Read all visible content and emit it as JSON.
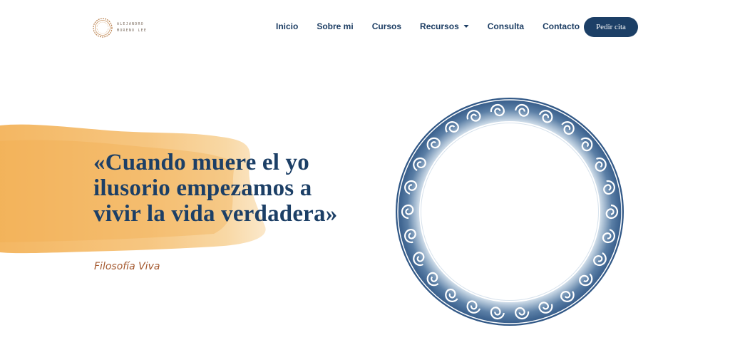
{
  "brand": {
    "logo_line1": "Alejandro",
    "logo_line2": "Moreno Lee"
  },
  "nav": {
    "items": [
      {
        "label": "Inicio"
      },
      {
        "label": "Sobre mi"
      },
      {
        "label": "Cursos"
      },
      {
        "label": "Recursos",
        "has_dropdown": true
      },
      {
        "label": "Consulta"
      },
      {
        "label": "Contacto"
      }
    ],
    "cta_label": "Pedir cita"
  },
  "hero": {
    "quote": "«Cuando muere el yo ilusorio empezamos a vivir la vida verdadera»",
    "attribution": "Filosofía Viva"
  },
  "colors": {
    "brand_blue": "#1c3f66",
    "nav_text": "#1c3d63",
    "accent_rust": "#a4582e",
    "watercolor_orange": "#f3b75d"
  },
  "icons": {
    "dropdown": "chevron-down-icon",
    "decorative_ring": "spiral-ring-illustration"
  }
}
